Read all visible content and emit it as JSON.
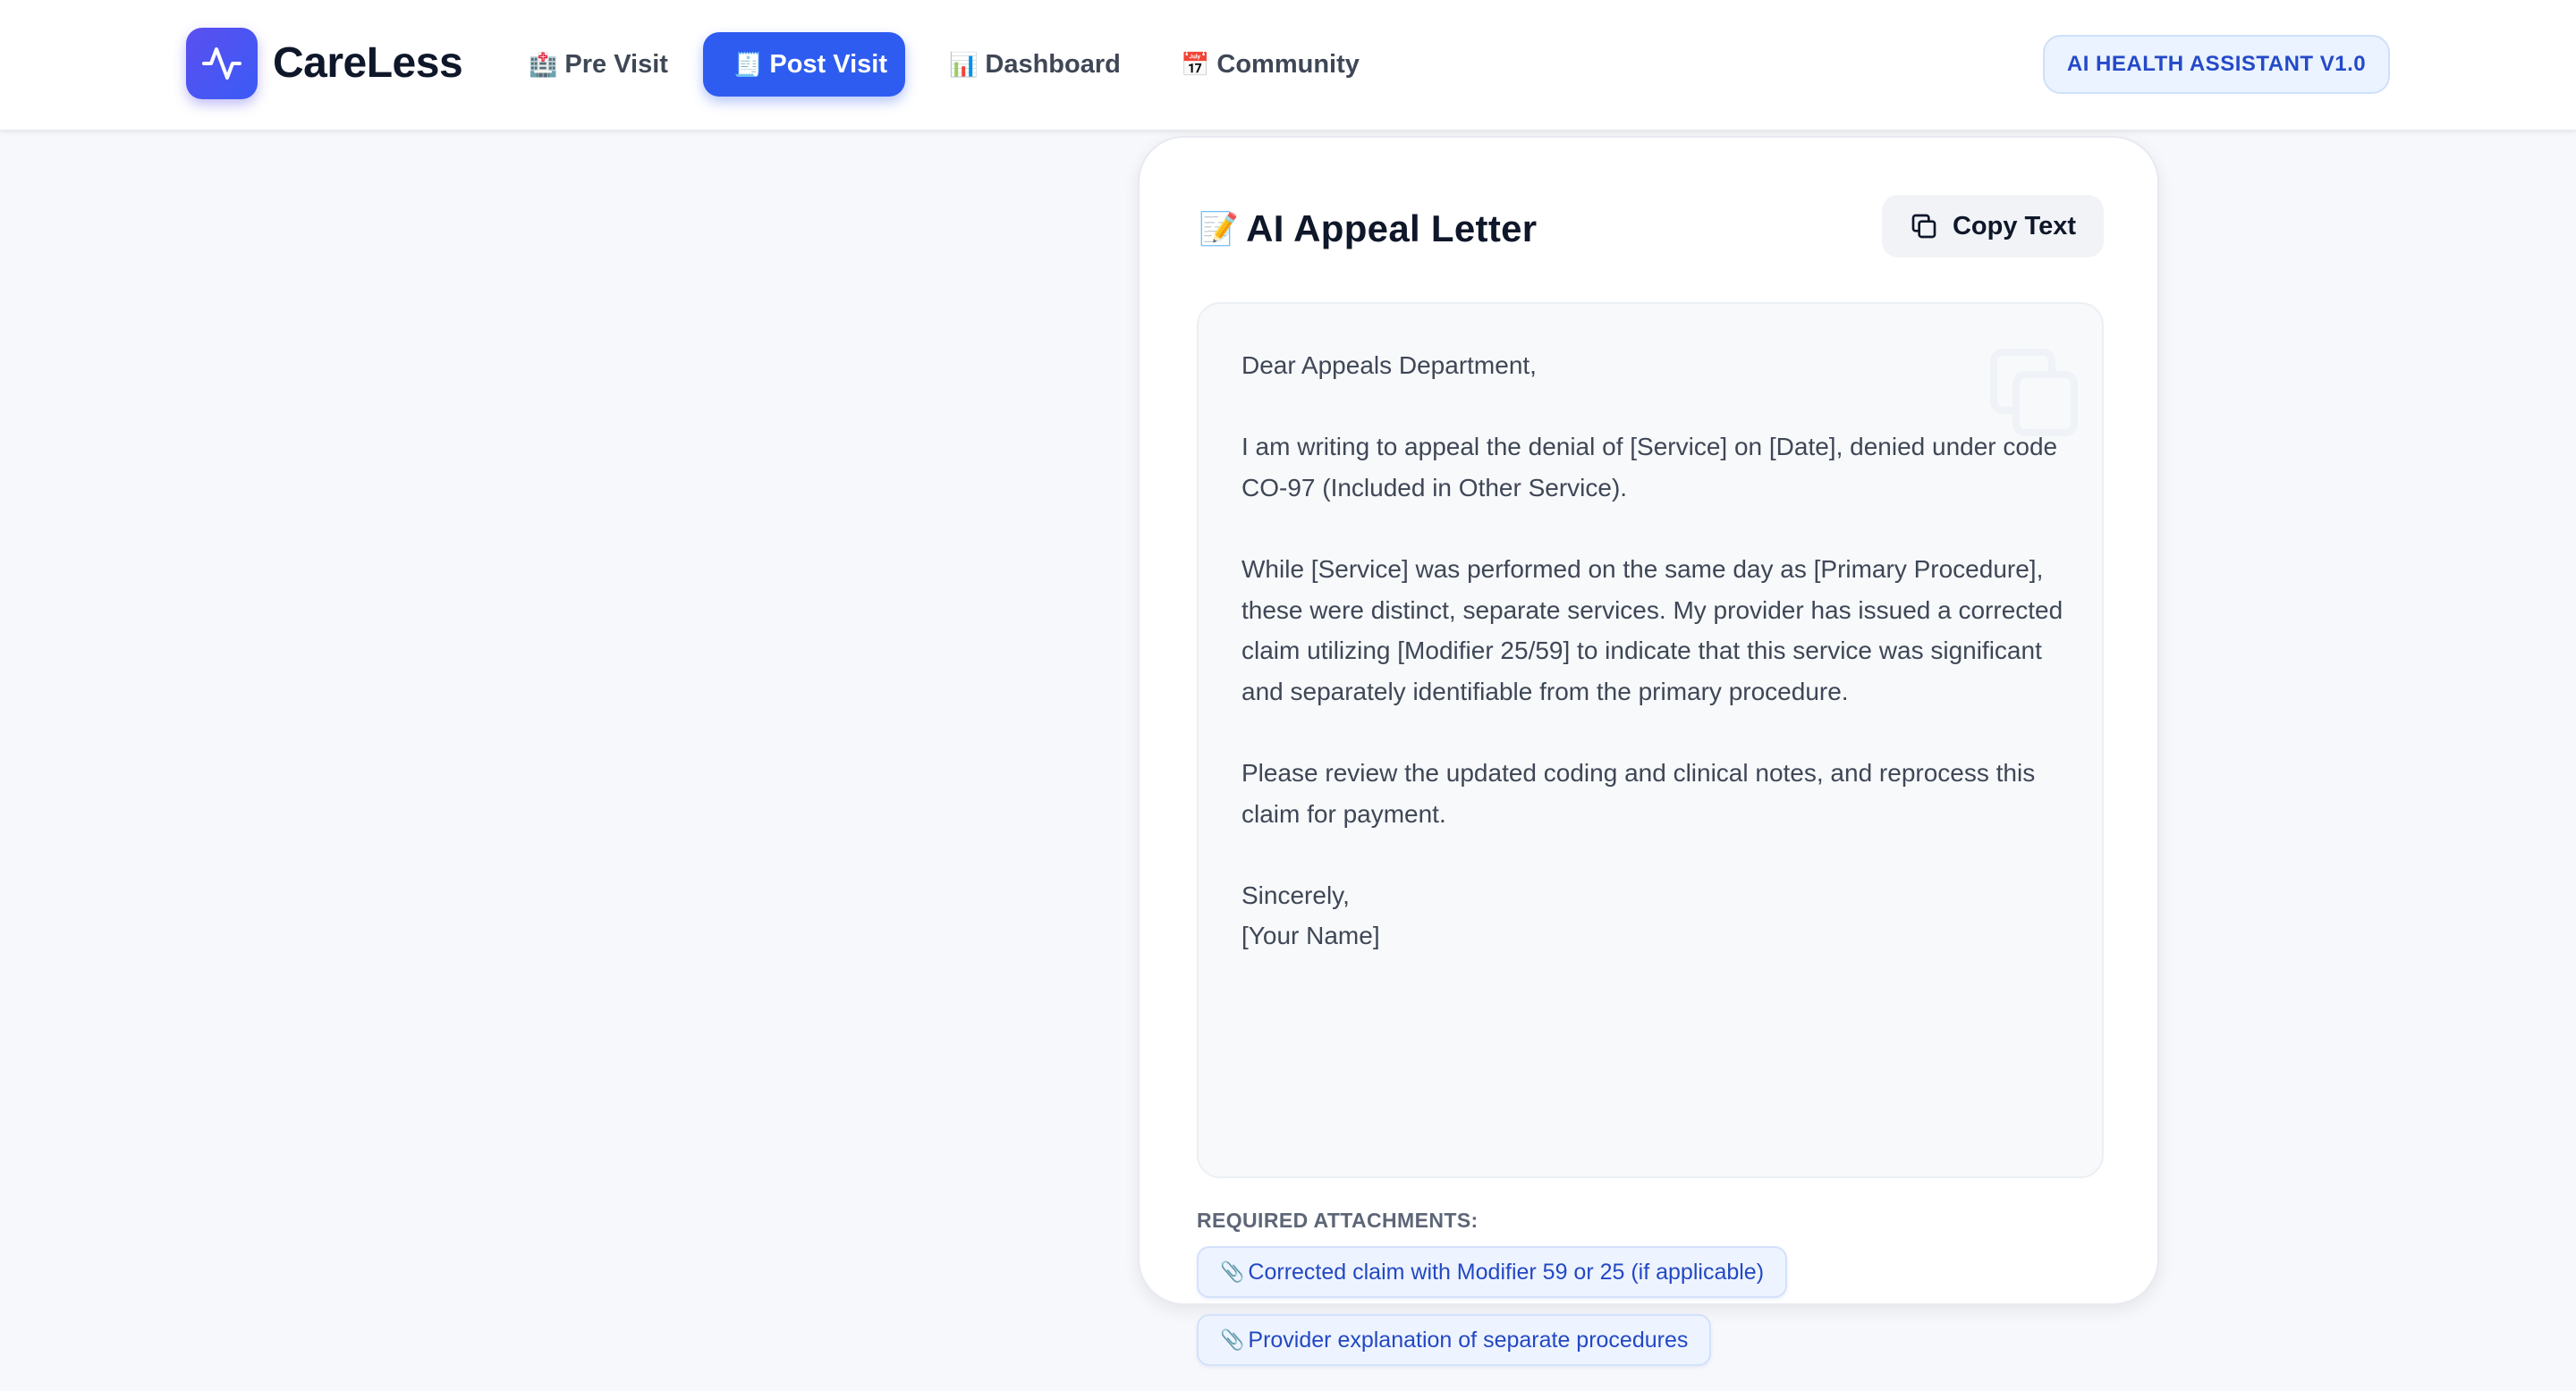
{
  "app": {
    "name": "CareLess",
    "logo_icon": "pulse-icon",
    "brand_color": "#4f46e5"
  },
  "nav": {
    "items": [
      {
        "icon": "🏥",
        "label": "Pre Visit",
        "active": false
      },
      {
        "icon": "🧾",
        "label": "Post Visit",
        "active": true
      },
      {
        "icon": "📊",
        "label": "Dashboard",
        "active": false
      },
      {
        "icon": "📅",
        "label": "Community",
        "active": false
      }
    ],
    "active_color": "#2f5cf0"
  },
  "header": {
    "badge": "AI HEALTH ASSISTANT V1.0"
  },
  "letter_card": {
    "icon": "📝",
    "title": "AI Appeal Letter",
    "copy_button": "Copy Text",
    "paragraphs": [
      "Dear Appeals Department,",
      "I am writing to appeal the denial of [Service] on [Date], denied under code CO-97 (Included in Other Service).",
      "While [Service] was performed on the same day as [Primary Procedure], these were distinct, separate services. My provider has issued a corrected claim utilizing [Modifier 25/59] to indicate that this service was significant and separately identifiable from the primary procedure.",
      "Please review the updated coding and clinical notes, and reprocess this claim for payment."
    ],
    "closing": "Sincerely,",
    "signature": "[Your Name]",
    "attachments_label": "REQUIRED ATTACHMENTS:",
    "attachments": [
      {
        "icon": "📎",
        "label": "Corrected claim with Modifier 59 or 25 (if applicable)"
      },
      {
        "icon": "📎",
        "label": "Provider explanation of separate procedures"
      }
    ]
  }
}
